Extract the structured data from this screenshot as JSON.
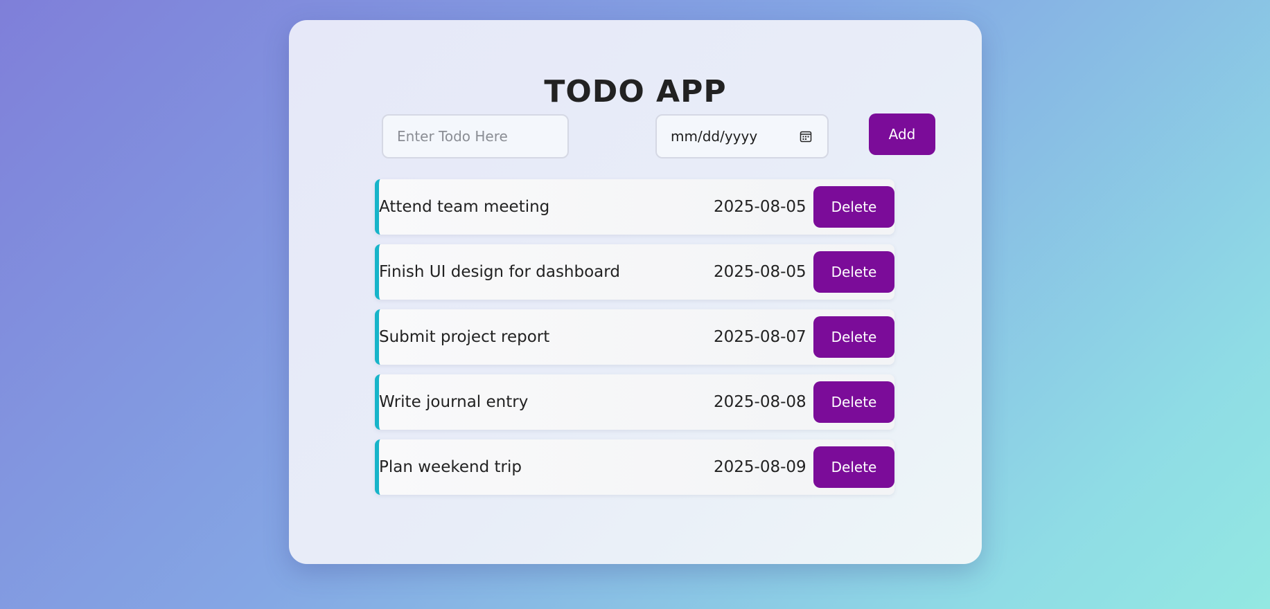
{
  "app": {
    "title": "TODO APP"
  },
  "form": {
    "todo_placeholder": "Enter Todo Here",
    "todo_value": "",
    "date_placeholder": "mm/dd/yyyy",
    "calendar_icon": "calendar-icon",
    "add_label": "Add"
  },
  "todos": [
    {
      "text": "Attend team meeting",
      "date": "2025-08-05",
      "delete_label": "Delete"
    },
    {
      "text": "Finish UI design for dashboard",
      "date": "2025-08-05",
      "delete_label": "Delete"
    },
    {
      "text": "Submit project report",
      "date": "2025-08-07",
      "delete_label": "Delete"
    },
    {
      "text": "Write journal entry",
      "date": "2025-08-08",
      "delete_label": "Delete"
    },
    {
      "text": "Plan weekend trip",
      "date": "2025-08-09",
      "delete_label": "Delete"
    }
  ],
  "colors": {
    "accent": "#7b0c99",
    "item_border": "#17b4c9",
    "text": "#222222"
  }
}
